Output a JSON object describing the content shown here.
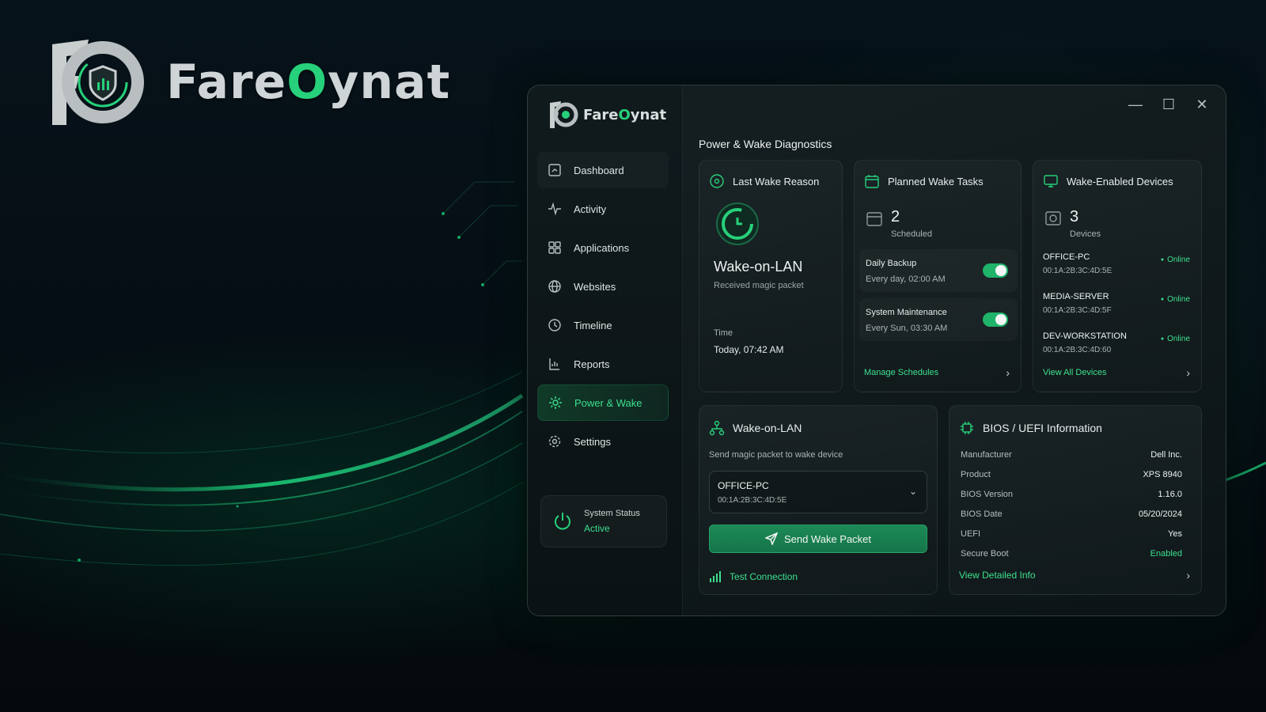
{
  "brand": {
    "name_part1": "Fare",
    "name_accent": "O",
    "name_part2": "ynat"
  },
  "window_controls": {
    "minimize": "—",
    "maximize": "☐",
    "close": "✕"
  },
  "sidebar": {
    "logo": {
      "part1": "Fare",
      "accent": "O",
      "part2": "ynat"
    },
    "items": [
      {
        "label": "Dashboard",
        "icon": "dashboard-icon"
      },
      {
        "label": "Activity",
        "icon": "activity-icon"
      },
      {
        "label": "Applications",
        "icon": "applications-icon"
      },
      {
        "label": "Websites",
        "icon": "globe-icon"
      },
      {
        "label": "Timeline",
        "icon": "timeline-icon"
      },
      {
        "label": "Reports",
        "icon": "reports-icon"
      },
      {
        "label": "Power & Wake",
        "icon": "gear-icon",
        "active": true
      },
      {
        "label": "Settings",
        "icon": "settings-icon"
      }
    ],
    "status": {
      "label": "System Status",
      "value": "Active"
    }
  },
  "main": {
    "title": "Power & Wake Diagnostics",
    "last_wake": {
      "title": "Last Wake Reason",
      "reason": "Wake-on-LAN",
      "detail": "Received magic packet",
      "time_label": "Time",
      "time_value": "Today, 07:42 AM"
    },
    "planned": {
      "title": "Planned Wake Tasks",
      "count": "2",
      "count_label": "Scheduled",
      "tasks": [
        {
          "name": "Daily Backup",
          "schedule": "Every day, 02:00 AM",
          "enabled": true
        },
        {
          "name": "System Maintenance",
          "schedule": "Every Sun, 03:30 AM",
          "enabled": true
        }
      ],
      "link": "Manage Schedules"
    },
    "devices": {
      "title": "Wake-Enabled Devices",
      "count": "3",
      "count_label": "Devices",
      "list": [
        {
          "name": "OFFICE-PC",
          "mac": "00:1A:2B:3C:4D:5E",
          "status": "Online"
        },
        {
          "name": "MEDIA-SERVER",
          "mac": "00:1A:2B:3C:4D:5F",
          "status": "Online"
        },
        {
          "name": "DEV-WORKSTATION",
          "mac": "00:1A:2B:3C:4D:60",
          "status": "Online"
        }
      ],
      "link": "View All Devices"
    },
    "wol": {
      "title": "Wake-on-LAN",
      "description": "Send magic packet to wake device",
      "selected_name": "OFFICE-PC",
      "selected_mac": "00:1A:2B:3C:4D:5E",
      "send_label": "Send Wake Packet",
      "test_label": "Test Connection"
    },
    "bios": {
      "title": "BIOS / UEFI Information",
      "rows": [
        {
          "key": "Manufacturer",
          "value": "Dell Inc."
        },
        {
          "key": "Product",
          "value": "XPS 8940"
        },
        {
          "key": "BIOS Version",
          "value": "1.16.0"
        },
        {
          "key": "BIOS Date",
          "value": "05/20/2024"
        },
        {
          "key": "UEFI",
          "value": "Yes"
        },
        {
          "key": "Secure Boot",
          "value": "Enabled"
        }
      ],
      "link": "View Detailed Info"
    }
  },
  "colors": {
    "accent": "#27d07a",
    "accent_light": "#3de08e",
    "background": "#06121a"
  }
}
